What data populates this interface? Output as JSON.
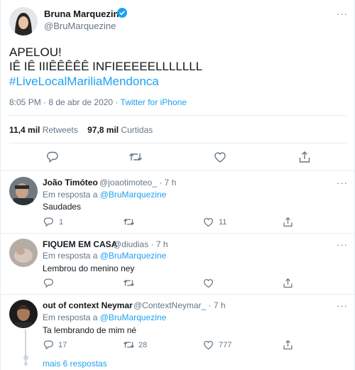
{
  "tweet": {
    "author_name": "Bruna Marquezine",
    "author_handle": "@BruMarquezine",
    "more_label": "···",
    "text_line1": "APELOU!",
    "text_line2": "IÊ IÊ IIIÊÊÊÊÊ INFIEEEEELLLLLLL",
    "hashtag": "#LiveLocalMariliaMendonca",
    "time": "8:05 PM · 8 de abr de 2020 · ",
    "source": "Twitter for iPhone",
    "retweets_count": "11,4 mil",
    "retweets_label": "Retweets",
    "likes_count": "97,8 mil",
    "likes_label": "Curtidas"
  },
  "replies": [
    {
      "name": "João Timóteo",
      "handle_time": "@joaotimoteo_ · 7 h",
      "in_reply_prefix": "Em resposta a ",
      "in_reply_to": "@BruMarquezine",
      "text": "Saudades",
      "reply_count": "1",
      "retweet_count": "",
      "like_count": "11"
    },
    {
      "name": "FIQUEM EM CASA",
      "handle_time": "@diudias · 7 h",
      "in_reply_prefix": "Em resposta a ",
      "in_reply_to": "@BruMarquezine",
      "text": "Lembrou do menino ney",
      "reply_count": "",
      "retweet_count": "",
      "like_count": ""
    },
    {
      "name": "out of context Neymar",
      "handle_time": "@ContextNeymar_ · 7 h",
      "in_reply_prefix": "Em resposta a ",
      "in_reply_to": "@BruMarquezine",
      "text": "Ta lembrando de mim né",
      "reply_count": "17",
      "retweet_count": "28",
      "like_count": "777"
    }
  ],
  "more_replies": "mais 6 respostas",
  "colors": {
    "accent": "#1da1f2",
    "secondary": "#657786",
    "border": "#e6ecf0"
  }
}
